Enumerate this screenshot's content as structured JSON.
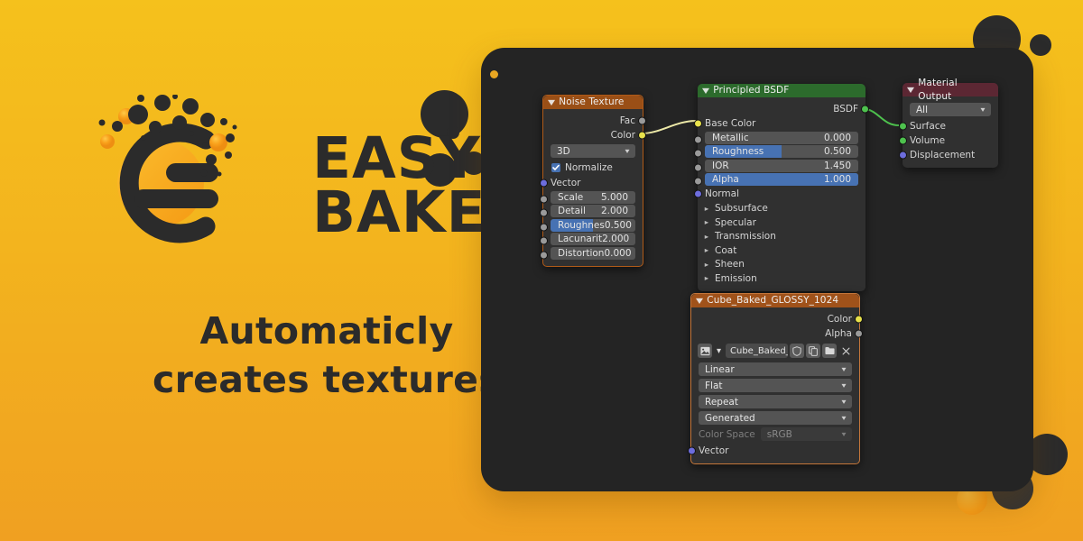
{
  "brand": {
    "logo_icon": "easybake-g-logo",
    "name_line1": "EASY",
    "name_line2": "BAKE",
    "tagline_line1": "Automaticly",
    "tagline_line2": "creates textures",
    "bg_top": "#F5C11C",
    "bg_bottom": "#F0A021",
    "ink": "#2B2B2B"
  },
  "editor": {
    "panel_bg": "#242424",
    "nodes": {
      "noise": {
        "title": "Noise Texture",
        "header_color": "#9a4f16",
        "outputs": [
          {
            "label": "Fac",
            "socket": "grey"
          },
          {
            "label": "Color",
            "socket": "yellow"
          }
        ],
        "dimension": "3D",
        "normalize_label": "Normalize",
        "normalize_checked": true,
        "vector_label": "Vector",
        "props": [
          {
            "name": "Scale",
            "value": "5.000",
            "fill": 0
          },
          {
            "name": "Detail",
            "value": "2.000",
            "fill": 0
          },
          {
            "name": "Roughnes",
            "value": "0.500",
            "fill": 50
          },
          {
            "name": "Lacunarit",
            "value": "2.000",
            "fill": 0
          },
          {
            "name": "Distortion",
            "value": "0.000",
            "fill": 0
          }
        ]
      },
      "bsdf": {
        "title": "Principled BSDF",
        "header_color": "#2c6b2c",
        "output_label": "BSDF",
        "base_color_label": "Base Color",
        "normal_label": "Normal",
        "props": [
          {
            "name": "Metallic",
            "value": "0.000",
            "fill": 0
          },
          {
            "name": "Roughness",
            "value": "0.500",
            "fill": 50
          },
          {
            "name": "IOR",
            "value": "1.450",
            "fill": 0
          },
          {
            "name": "Alpha",
            "value": "1.000",
            "fill": 100
          }
        ],
        "panels": [
          "Subsurface",
          "Specular",
          "Transmission",
          "Coat",
          "Sheen",
          "Emission"
        ]
      },
      "output": {
        "title": "Material Output",
        "header_color": "#5c2733",
        "target": "All",
        "inputs": [
          {
            "label": "Surface",
            "socket": "green"
          },
          {
            "label": "Volume",
            "socket": "green"
          },
          {
            "label": "Displacement",
            "socket": "purple"
          }
        ]
      },
      "image": {
        "title": "Cube_Baked_GLOSSY_1024",
        "header_color": "#a0521a",
        "outputs": [
          {
            "label": "Color",
            "socket": "yellow"
          },
          {
            "label": "Alpha",
            "socket": "grey"
          }
        ],
        "datablock_name": "Cube_Baked_GL...",
        "toolbar_icons": [
          "image-icon",
          "chevron-down-icon",
          "shield-icon",
          "copy-icon",
          "folder-icon",
          "close-icon"
        ],
        "interpolation": "Linear",
        "projection": "Flat",
        "extension": "Repeat",
        "source": "Generated",
        "color_space_label": "Color Space",
        "color_space_value": "sRGB",
        "vector_label": "Vector"
      }
    },
    "links": [
      {
        "from": "noise.Color",
        "to": "bsdf.Base Color",
        "color": "#EDE9A8"
      },
      {
        "from": "bsdf.BSDF",
        "to": "output.Surface",
        "color": "#4ec24e"
      }
    ]
  }
}
